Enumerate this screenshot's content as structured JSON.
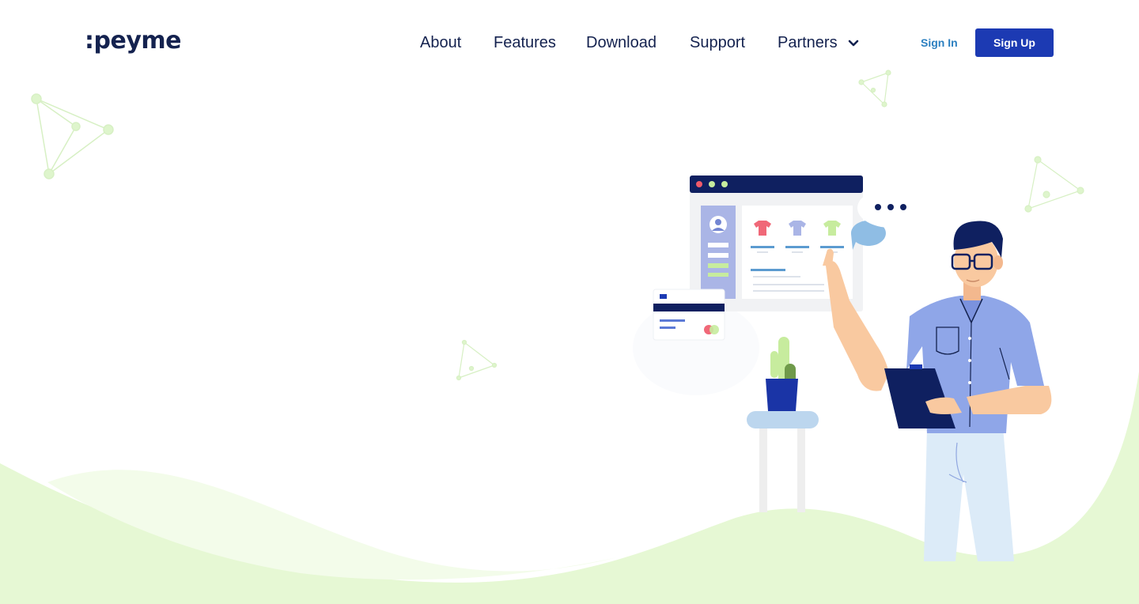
{
  "brand": {
    "logo_text": ":peyme"
  },
  "nav": {
    "items": [
      {
        "label": "About"
      },
      {
        "label": "Features"
      },
      {
        "label": "Download"
      },
      {
        "label": "Support"
      },
      {
        "label": "Partners",
        "has_dropdown": true
      }
    ]
  },
  "auth": {
    "sign_in_label": "Sign In",
    "sign_up_label": "Sign Up"
  },
  "colors": {
    "brand_navy": "#14224f",
    "primary_button": "#1c3ab3",
    "sign_in_link": "#2b7fc0",
    "wave_green": "#e6f8d4"
  },
  "illustration": {
    "chat_bubble_text": "• • •",
    "icons": [
      "browser-window",
      "tshirt-icon",
      "payment-card",
      "cactus-plant",
      "chat-bubble",
      "clipboard",
      "person"
    ]
  }
}
